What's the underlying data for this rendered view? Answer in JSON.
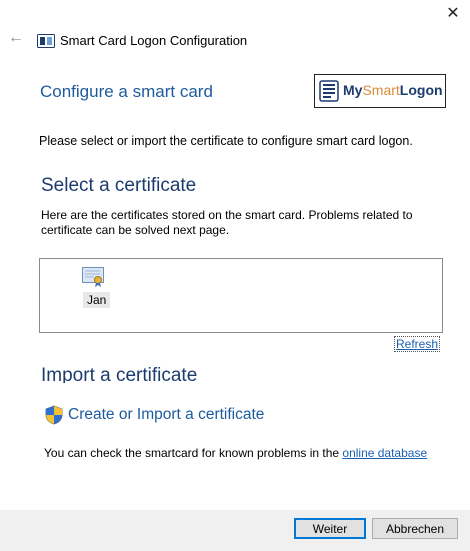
{
  "window": {
    "title": "Smart Card Logon Configuration",
    "close_glyph": "✕",
    "back_glyph": "←"
  },
  "header": {
    "heading": "Configure a smart card",
    "logo": {
      "my": "My",
      "smart": "Smart",
      "logon": "Logon"
    }
  },
  "instruction": "Please select or import the certificate to configure smart card logon.",
  "select_section": {
    "title": "Select a certificate",
    "description": "Here are the certificates stored on the smart card. Problems related to certificate can be solved next page.",
    "certificates": [
      {
        "label": "Jan"
      }
    ],
    "refresh_label": "Refresh"
  },
  "import_section": {
    "title": "Import a certificate",
    "create_label": "Create or Import a certificate",
    "check_text": "You can check the smartcard for known problems in the ",
    "online_link": "online database"
  },
  "footer": {
    "next_label": "Weiter",
    "cancel_label": "Abbrechen"
  },
  "colors": {
    "accent": "#1d5b9e",
    "link": "#1a5fb4",
    "logo_orange": "#d98b3a"
  }
}
